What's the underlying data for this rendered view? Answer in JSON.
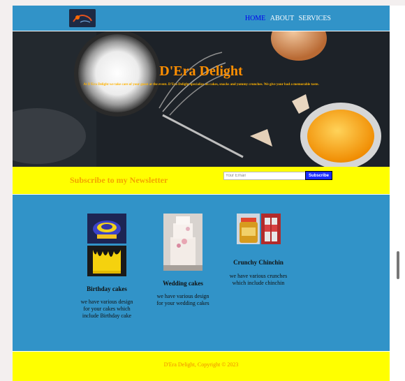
{
  "nav": {
    "home": "HOME",
    "about": "ABOUT",
    "services": "SERVICES"
  },
  "hero": {
    "title": "D'Era Delight",
    "description": "At D'Era Delight we take care of your guest at the event. D'Era Delight specialize on cakes, snacks and yummy crunches. We give your bad a memorable taste."
  },
  "newsletter": {
    "title": "Subscribe to my Newsletter",
    "placeholder": "Your Email",
    "button": "Subscribe"
  },
  "products": [
    {
      "title": "Birthday cakes",
      "description": "we have various design for your cakes which include Birthday cake"
    },
    {
      "title": "Wedding cakes",
      "description": "we have various design for your wedding cakes"
    },
    {
      "title": "Crunchy Chinchin",
      "description": "we have various crunches which include chinchin"
    }
  ],
  "footer": {
    "copyright": "D'Era Delight, Copyright © 2023"
  },
  "colors": {
    "header": "#3193c8",
    "accent": "#ff8f00",
    "band": "#ffff00",
    "button": "#1a2cff"
  }
}
